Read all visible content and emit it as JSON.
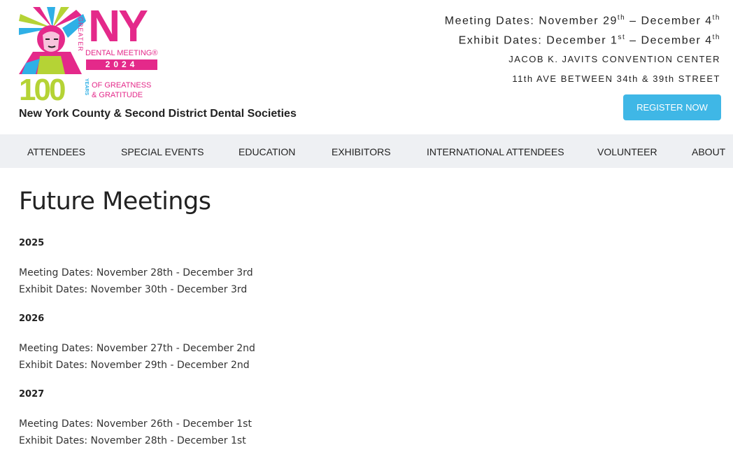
{
  "logo": {
    "greater": "GREATER",
    "ny": "NY",
    "dental_meeting": "DENTAL MEETING®",
    "year": "2024",
    "hundred": "100",
    "years": "YEARS",
    "tagline_1": "OF GREATNESS",
    "tagline_2": "& GRATITUDE"
  },
  "society": "New York County & Second District Dental Societies",
  "header_info": {
    "meeting_prefix": "Meeting Dates: November 29",
    "meeting_sup1": "th",
    "meeting_mid": " – December 4",
    "meeting_sup2": "th",
    "exhibit_prefix": "Exhibit Dates: December 1",
    "exhibit_sup1": "st",
    "exhibit_mid": " – December 4",
    "exhibit_sup2": "th",
    "venue": "JACOB K. JAVITS CONVENTION CENTER",
    "street": "11th AVE BETWEEN 34th & 39th STREET"
  },
  "register_label": "REGISTER NOW",
  "nav": [
    "ATTENDEES",
    "SPECIAL EVENTS",
    "EDUCATION",
    "EXHIBITORS",
    "INTERNATIONAL ATTENDEES",
    "VOLUNTEER",
    "ABOUT"
  ],
  "page_title": "Future Meetings",
  "meetings": [
    {
      "year": "2025",
      "meeting": "Meeting Dates: November 28th - December 3rd",
      "exhibit": "Exhibit Dates: November 30th - December 3rd"
    },
    {
      "year": "2026",
      "meeting": "Meeting Dates: November 27th - December 2nd",
      "exhibit": "Exhibit Dates: November 29th - December 2nd"
    },
    {
      "year": "2027",
      "meeting": "Meeting Dates: November 26th - December 1st",
      "exhibit": "Exhibit Dates: November 28th - December 1st"
    }
  ],
  "colors": {
    "brand_pink": "#e4298a",
    "brand_green": "#b5d335",
    "brand_blue": "#2fb0e6",
    "button": "#3fb7e6",
    "nav_bg": "#eef0f3"
  }
}
